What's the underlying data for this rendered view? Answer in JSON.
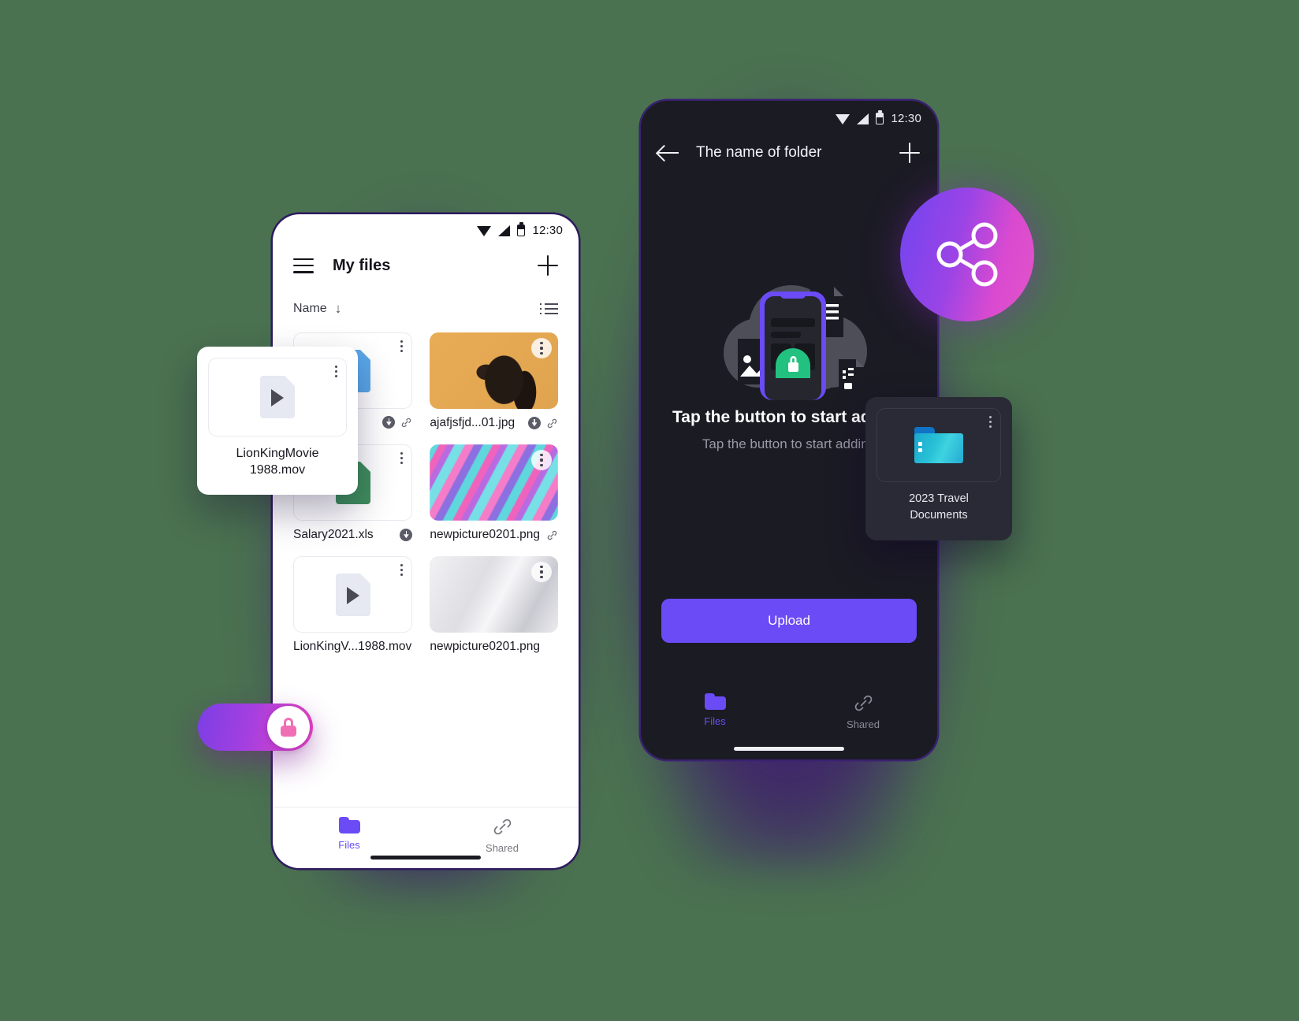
{
  "background_color": "#4a7150",
  "light_phone": {
    "status_bar": {
      "time": "12:30",
      "icons": [
        "wifi-icon",
        "signal-icon",
        "battery-icon"
      ]
    },
    "app_bar": {
      "menu_icon": "hamburger-icon",
      "title": "My files",
      "add_icon": "plus-icon"
    },
    "sort_bar": {
      "label": "Name",
      "direction_icon": "arrow-down-icon",
      "view_icon": "list-view-icon"
    },
    "files": [
      {
        "name": "",
        "kind": "doc",
        "badges": [
          "download-icon",
          "link-icon"
        ]
      },
      {
        "name": "ajafjsfjd...01.jpg",
        "kind": "image-woman",
        "badges": [
          "download-icon",
          "link-icon"
        ]
      },
      {
        "name": "Salary2021.xls",
        "kind": "sheet",
        "badges": [
          "download-icon"
        ]
      },
      {
        "name": "newpicture0201.png",
        "kind": "image-marble",
        "badges": [
          "link-icon"
        ]
      },
      {
        "name": "LionKingV...1988.mov",
        "kind": "video",
        "badges": []
      },
      {
        "name": "newpicture0201.png",
        "kind": "image-gray",
        "badges": []
      }
    ],
    "bottom_nav": [
      {
        "label": "Files",
        "icon": "folder-icon",
        "active": true,
        "color": "#6a4bf5"
      },
      {
        "label": "Shared",
        "icon": "link-icon",
        "active": false,
        "color": "#77777f"
      }
    ]
  },
  "movie_card": {
    "icon": "video-file-icon",
    "menu_icon": "kebab-menu-icon",
    "name_line1": "LionKingMovie",
    "name_line2": "1988.mov"
  },
  "lock_toggle": {
    "icon": "lock-icon",
    "state": "on",
    "gradient_from": "#7b3fe4",
    "gradient_to": "#e844c0"
  },
  "dark_phone": {
    "status_bar": {
      "time": "12:30",
      "icons": [
        "wifi-icon",
        "signal-icon",
        "battery-icon"
      ]
    },
    "app_bar": {
      "back_icon": "back-arrow-icon",
      "title": "The name of folder",
      "add_icon": "plus-icon"
    },
    "empty_state": {
      "illustration": "cloud-phone-lock-illustration",
      "title": "Tap the button to start adding",
      "subtitle": "Tap the button to start adding"
    },
    "upload_button": {
      "label": "Upload",
      "color": "#6a4bf5"
    },
    "bottom_nav": [
      {
        "label": "Files",
        "icon": "folder-icon",
        "active": true,
        "color": "#6a4bf5"
      },
      {
        "label": "Shared",
        "icon": "link-icon",
        "active": false,
        "color": "#8a8a96"
      }
    ]
  },
  "share_fab": {
    "icon": "share-icon",
    "gradient_from": "#6f45f0",
    "gradient_to": "#e254c8"
  },
  "folder_card": {
    "icon": "blue-folder-icon",
    "menu_icon": "kebab-menu-icon",
    "name_line1": "2023 Travel",
    "name_line2": "Documents"
  }
}
